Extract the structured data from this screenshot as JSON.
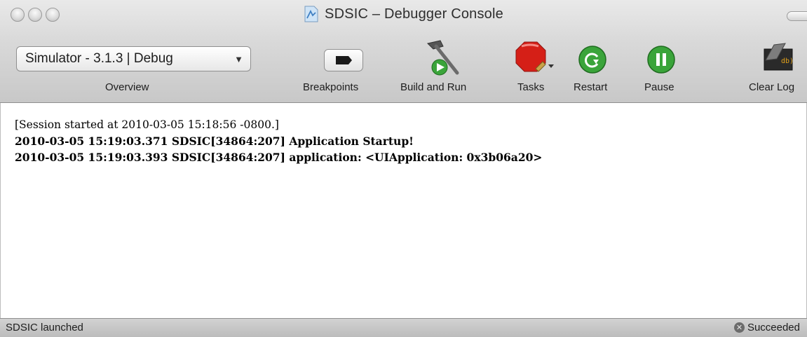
{
  "window": {
    "title": "SDSIC – Debugger Console"
  },
  "toolbar": {
    "scheme_popup": "Simulator - 3.1.3 | Debug",
    "overview_label": "Overview",
    "breakpoints_label": "Breakpoints",
    "build_run_label": "Build and Run",
    "tasks_label": "Tasks",
    "restart_label": "Restart",
    "pause_label": "Pause",
    "clear_log_label": "Clear Log"
  },
  "icons": {
    "breakpoints": "breakpoint-arrow-icon",
    "build_run": "hammer-run-icon",
    "tasks": "stop-sign-icon",
    "restart": "restart-icon",
    "pause": "pause-icon",
    "clear_log": "clear-log-icon",
    "status": "x-circle-icon"
  },
  "colors": {
    "restart_green": "#3aa43a",
    "pause_green": "#3aa43a",
    "tasks_red": "#d51f17"
  },
  "console": {
    "lines": [
      "[Session started at 2010-03-05 15:18:56 -0800.]",
      "2010-03-05 15:19:03.371 SDSIC[34864:207] Application Startup!",
      "2010-03-05 15:19:03.393 SDSIC[34864:207] application: <UIApplication: 0x3b06a20>"
    ]
  },
  "status": {
    "left": "SDSIC launched",
    "right": "Succeeded",
    "x_glyph": "✕"
  }
}
